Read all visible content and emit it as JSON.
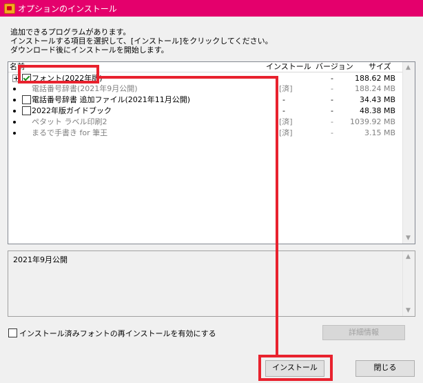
{
  "window": {
    "title": "オプションのインストール"
  },
  "instructions": [
    "追加できるプログラムがあります。",
    "インストールする項目を選択して、[インストール]をクリックしてください。",
    "ダウンロード後にインストールを開始します。"
  ],
  "list": {
    "columns": {
      "name": "名前",
      "install": "インストール",
      "version": "バージョン",
      "size": "サイズ"
    },
    "rows": [
      {
        "name": "フォント(2022年版)",
        "install": "",
        "version": "-",
        "size": "188.62 MB"
      },
      {
        "name": "電話番号辞書(2021年9月公開)",
        "install": "[済]",
        "version": "-",
        "size": "188.24 MB"
      },
      {
        "name": "電話番号辞書 追加ファイル(2021年11月公開)",
        "install": "-",
        "version": "-",
        "size": "34.43 MB"
      },
      {
        "name": "2022年版ガイドブック",
        "install": "-",
        "version": "-",
        "size": "48.38 MB"
      },
      {
        "name": "ペタット ラベル印刷2",
        "install": "[済]",
        "version": "-",
        "size": "1039.92 MB"
      },
      {
        "name": "まるで手書き for 筆王",
        "install": "[済]",
        "version": "-",
        "size": "3.15 MB"
      }
    ]
  },
  "description": {
    "text": "2021年9月公開"
  },
  "reinstall_label": "インストール済みフォントの再インストールを有効にする",
  "buttons": {
    "details": "詳細情報",
    "install": "インストール",
    "close": "閉じる"
  },
  "colors": {
    "titlebar": "#e4006c",
    "highlight": "#e8222e"
  }
}
